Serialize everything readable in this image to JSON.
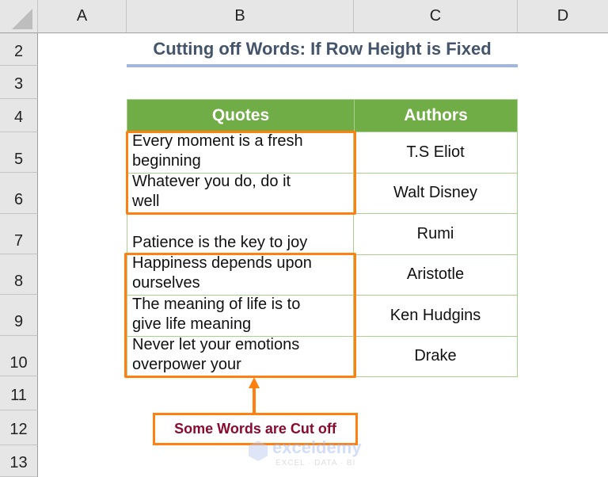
{
  "columns": [
    "A",
    "B",
    "C",
    "D"
  ],
  "rows": [
    "2",
    "3",
    "4",
    "5",
    "6",
    "7",
    "8",
    "9",
    "10",
    "11",
    "12",
    "13"
  ],
  "title": "Cutting off Words: If Row Height is Fixed",
  "table": {
    "headers": [
      "Quotes",
      "Authors"
    ],
    "rows": [
      {
        "quote_line1": "Every moment is a fresh",
        "quote_line2": "beginning",
        "author": "T.S Eliot"
      },
      {
        "quote_line1": "Whatever you do, do it",
        "quote_line2": "well",
        "author": "Walt Disney"
      },
      {
        "quote_line1": "",
        "quote_line2": "Patience is the key to joy",
        "author": "Rumi"
      },
      {
        "quote_line1": "Happiness depends upon",
        "quote_line2": "ourselves",
        "author": "Aristotle"
      },
      {
        "quote_line1": "The meaning of life is to",
        "quote_line2": "give life meaning",
        "author": "Ken Hudgins"
      },
      {
        "quote_line1": "Never let your emotions",
        "quote_line2": "overpower your",
        "author": "Drake"
      }
    ]
  },
  "callout": "Some Words are Cut off",
  "watermark": {
    "name": "exceldemy",
    "tagline": "EXCEL · DATA · BI"
  },
  "colors": {
    "header_green": "#70ad47",
    "border_green": "#a9d08e",
    "highlight_orange": "#ff7f11",
    "title": "#44546a",
    "callout_text": "#8b0a2e"
  }
}
